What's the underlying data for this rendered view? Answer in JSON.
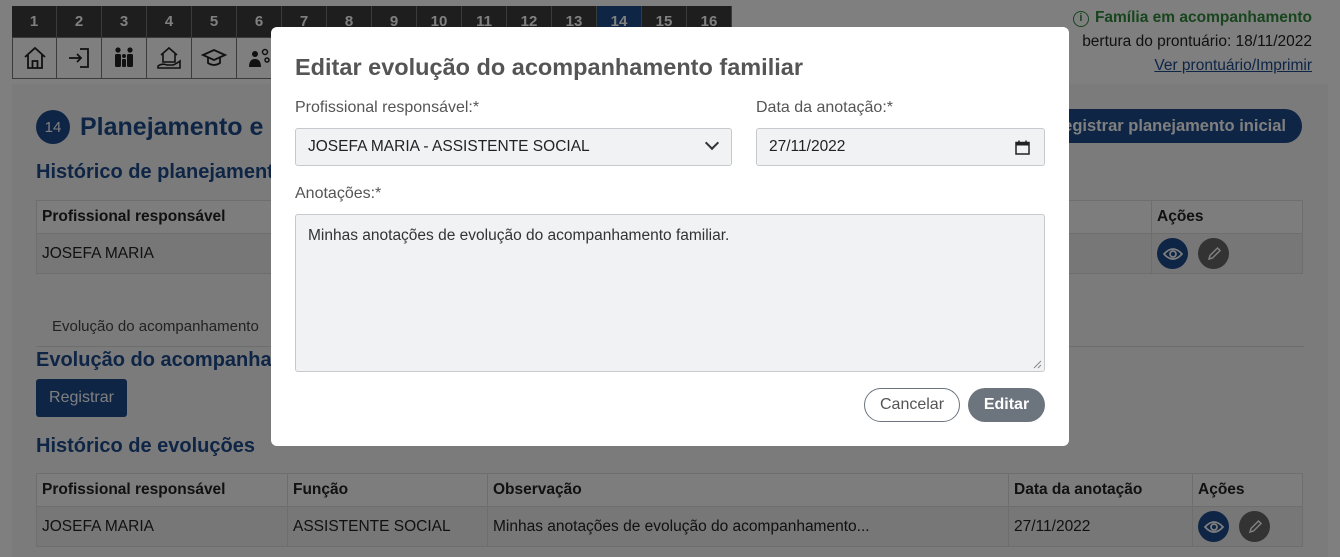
{
  "tabs": {
    "numbers": [
      "1",
      "2",
      "3",
      "4",
      "5",
      "6",
      "7",
      "8",
      "9",
      "10",
      "11",
      "12",
      "13",
      "14",
      "15",
      "16"
    ],
    "active": "14",
    "icons": [
      "home-icon",
      "login-icon",
      "family-icon",
      "house-hand-icon",
      "graduation-cap-icon",
      "people-gear-icon"
    ]
  },
  "status": {
    "family": "Família em acompanhamento",
    "opening": "bertura do prontuário: 18/11/2022",
    "link": "Ver prontuário/Imprimir"
  },
  "page": {
    "step": "14",
    "title": "Planejamento e e",
    "register_plan_button": "Registrar planejamento inicial",
    "history_plan_heading": "Histórico de planejament",
    "plan_table": {
      "headers": [
        "Profissional responsável",
        "Ações"
      ],
      "rows": [
        {
          "professional": "JOSEFA MARIA"
        }
      ]
    },
    "evolution_note": "Evolução do acompanhamento",
    "evolution_heading": "Evolução do acompanham",
    "register_button": "Registrar",
    "history_evolutions_heading": "Histórico de evoluções",
    "evolutions_table": {
      "headers": [
        "Profissional responsável",
        "Função",
        "Observação",
        "Data da anotação",
        "Ações"
      ],
      "rows": [
        {
          "professional": "JOSEFA MARIA",
          "role": "ASSISTENTE SOCIAL",
          "observation": "Minhas anotações de evolução do acompanhamento...",
          "date": "27/11/2022"
        }
      ]
    }
  },
  "modal": {
    "title": "Editar evolução do acompanhamento familiar",
    "professional_label": "Profissional responsável:*",
    "professional_value": "JOSEFA MARIA - ASSISTENTE SOCIAL",
    "date_label": "Data da anotação:*",
    "date_value": "27/11/2022",
    "notes_label": "Anotações:*",
    "notes_value": "Minhas anotações de evolução do acompanhamento familiar.",
    "cancel_button": "Cancelar",
    "edit_button": "Editar"
  },
  "colors": {
    "primary": "#1c4a8c",
    "success": "#2e8b3a",
    "secondary": "#6c757d"
  }
}
